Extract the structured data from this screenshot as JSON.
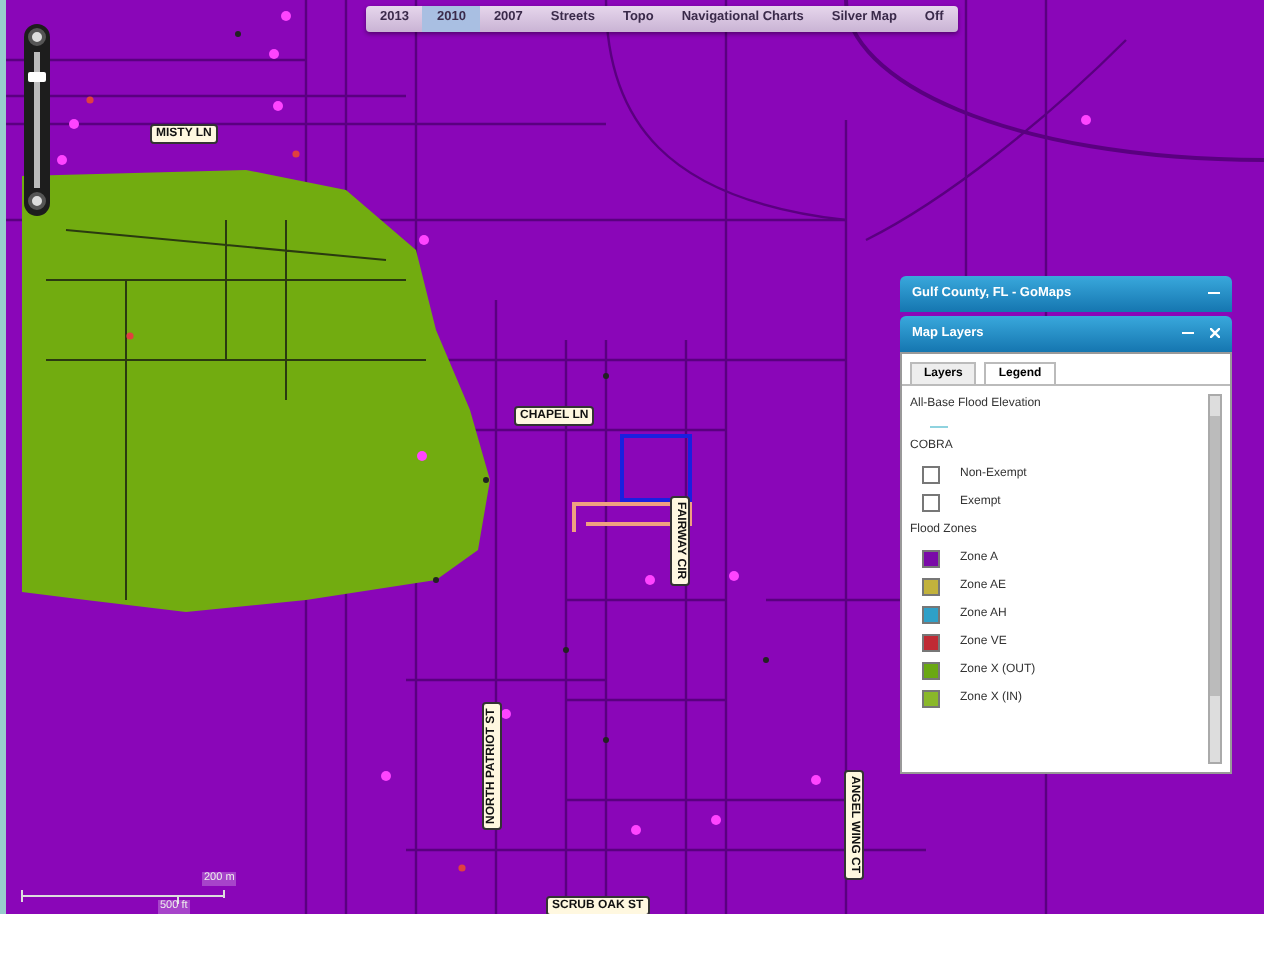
{
  "basemap_tabs": [
    {
      "label": "2013",
      "selected": false
    },
    {
      "label": "2010",
      "selected": true
    },
    {
      "label": "2007",
      "selected": false
    },
    {
      "label": "Streets",
      "selected": false
    },
    {
      "label": "Topo",
      "selected": false
    },
    {
      "label": "Navigational Charts",
      "selected": false
    },
    {
      "label": "Silver Map",
      "selected": false
    },
    {
      "label": "Off",
      "selected": false
    }
  ],
  "zoom_slider": {
    "level": 0.82
  },
  "road_labels": [
    {
      "text": "MISTY LN",
      "kind": "flat"
    },
    {
      "text": "CHAPEL LN",
      "kind": "flat"
    },
    {
      "text": "FAIRWAY CIR",
      "kind": "down"
    },
    {
      "text": "NORTH PATRIOT ST",
      "kind": "up"
    },
    {
      "text": "SCRUB OAK ST",
      "kind": "flat"
    },
    {
      "text": "ANGEL WING CT",
      "kind": "down"
    }
  ],
  "scale_bar": {
    "metric": "200 m",
    "imperial": "500 ft"
  },
  "app_panel": {
    "title": "Gulf County, FL - GoMaps"
  },
  "layers_panel": {
    "title": "Map Layers",
    "tabs": [
      {
        "label": "Layers",
        "selected": false
      },
      {
        "label": "Legend",
        "selected": true
      }
    ],
    "legend": [
      {
        "kind": "heading",
        "label": "All-Base Flood Elevation"
      },
      {
        "kind": "line",
        "color": "#8fd3df"
      },
      {
        "kind": "heading",
        "label": "COBRA"
      },
      {
        "kind": "swatch",
        "label": "Non-Exempt",
        "color": "#ffffff"
      },
      {
        "kind": "swatch",
        "label": "Exempt",
        "color": "#ffffff"
      },
      {
        "kind": "heading",
        "label": "Flood Zones"
      },
      {
        "kind": "swatch",
        "label": "Zone A",
        "color": "#7a0aa8"
      },
      {
        "kind": "swatch",
        "label": "Zone AE",
        "color": "#c2b23c"
      },
      {
        "kind": "swatch",
        "label": "Zone AH",
        "color": "#2fa0c8"
      },
      {
        "kind": "swatch",
        "label": "Zone VE",
        "color": "#c02a34"
      },
      {
        "kind": "swatch",
        "label": "Zone X (OUT)",
        "color": "#6aa812"
      },
      {
        "kind": "swatch",
        "label": "Zone X (IN)",
        "color": "#8ab82a"
      }
    ]
  }
}
